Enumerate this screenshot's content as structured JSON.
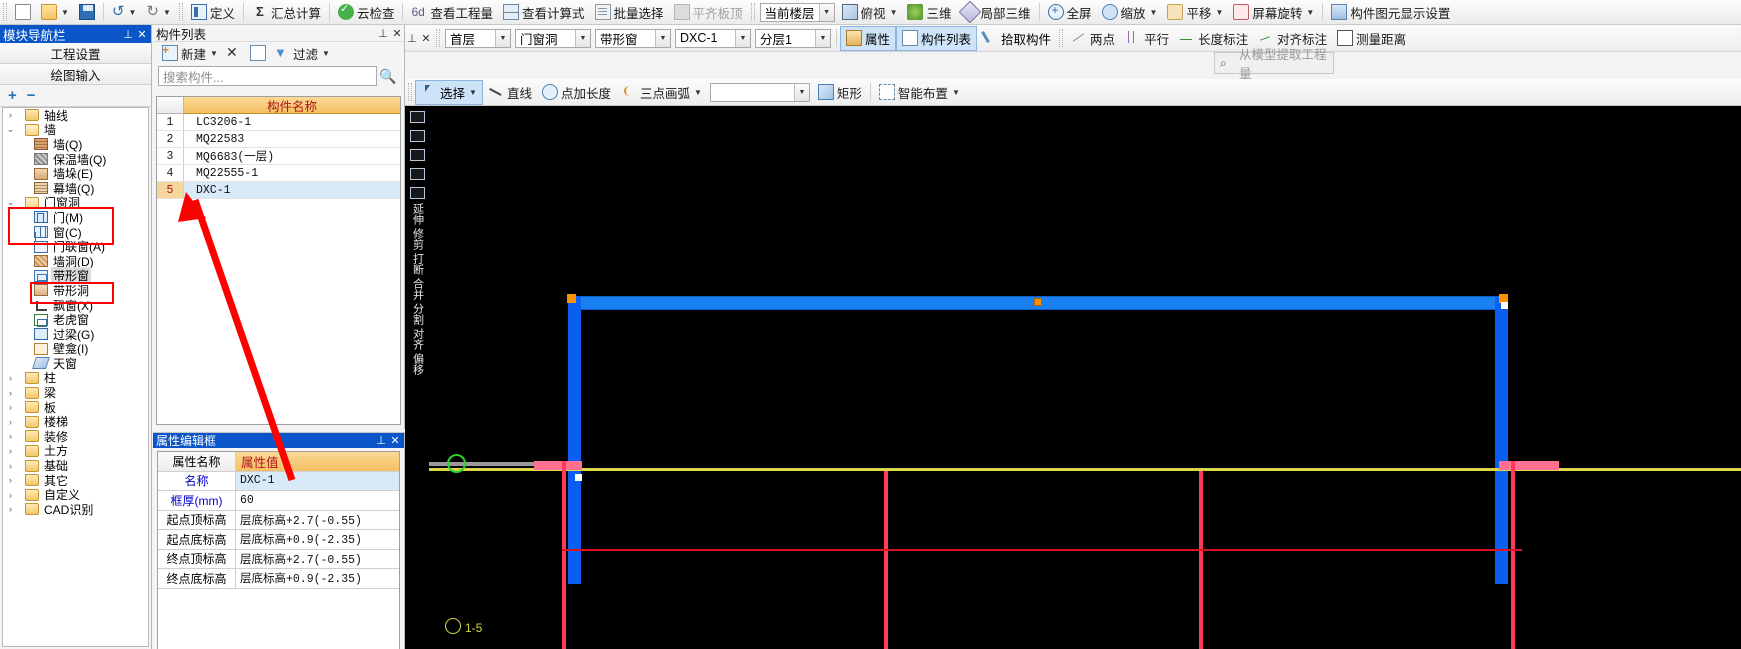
{
  "app": {
    "accent_blue": "#0a56c8",
    "header_orange": "#f4c063",
    "annotation_red": "#ff0000"
  },
  "toolbar_top": {
    "file_items": [
      {
        "name": "new-file",
        "icon": "document-icon",
        "label": ""
      },
      {
        "name": "open-file",
        "icon": "folder-open-icon",
        "label": ""
      },
      {
        "name": "save-file",
        "icon": "save-icon",
        "label": ""
      },
      {
        "name": "undo",
        "icon": "undo-arrow-icon",
        "label": ""
      },
      {
        "name": "redo",
        "icon": "redo-arrow-icon",
        "label": ""
      }
    ],
    "items": [
      {
        "label": "定义",
        "icon": "define-icon",
        "disabled": false,
        "caret": false
      },
      {
        "label": "汇总计算",
        "icon": "sigma-icon",
        "disabled": false,
        "caret": false
      },
      {
        "label": "云检查",
        "icon": "cloud-check-icon",
        "disabled": false,
        "caret": false
      },
      {
        "label": "查看工程量",
        "icon": "view-quantity-icon",
        "disabled": false,
        "caret": false
      },
      {
        "label": "查看计算式",
        "icon": "view-formula-icon",
        "disabled": false,
        "caret": false
      },
      {
        "label": "批量选择",
        "icon": "batch-select-icon",
        "disabled": false,
        "caret": false
      },
      {
        "label": "平齐板顶",
        "icon": "flush-slab-icon",
        "disabled": true,
        "caret": false
      }
    ],
    "floor_select": "当前楼层",
    "view_items": [
      {
        "label": "俯视",
        "icon": "top-view-icon",
        "caret": true
      },
      {
        "label": "三维",
        "icon": "three-d-icon",
        "caret": false
      },
      {
        "label": "局部三维",
        "icon": "partial-three-d-icon",
        "caret": false
      }
    ],
    "zoom_items": [
      {
        "label": "全屏",
        "icon": "fullscreen-icon",
        "caret": false
      },
      {
        "label": "缩放",
        "icon": "zoom-icon",
        "caret": true
      },
      {
        "label": "平移",
        "icon": "pan-icon",
        "caret": true
      },
      {
        "label": "屏幕旋转",
        "icon": "screen-rotate-icon",
        "caret": true
      },
      {
        "label": "构件图元显示设置",
        "icon": "element-display-icon",
        "caret": false
      }
    ]
  },
  "nav_panel": {
    "title": "模块导航栏",
    "pin": "📌",
    "close": "✕",
    "buttons": [
      "工程设置",
      "绘图输入"
    ],
    "expand_all": "+",
    "collapse_all": "−",
    "tree": [
      {
        "label": "轴线",
        "level": 0,
        "type": "folder",
        "expander": ">",
        "icon": "folder-icon"
      },
      {
        "label": "墙",
        "level": 0,
        "type": "folder",
        "expander": "v",
        "icon": "folder-open-icon"
      },
      {
        "label": "墙(Q)",
        "level": 1,
        "type": "leaf",
        "icon": "wall-icon"
      },
      {
        "label": "保温墙(Q)",
        "level": 1,
        "type": "leaf",
        "icon": "insulation-wall-icon"
      },
      {
        "label": "墙垛(E)",
        "level": 1,
        "type": "leaf",
        "icon": "wall-pier-icon"
      },
      {
        "label": "幕墙(Q)",
        "level": 1,
        "type": "leaf",
        "icon": "curtain-wall-icon"
      },
      {
        "label": "门窗洞",
        "level": 0,
        "type": "folder",
        "expander": "v",
        "icon": "folder-open-icon",
        "highlight_box": true
      },
      {
        "label": "门(M)",
        "level": 1,
        "type": "leaf",
        "icon": "door-icon",
        "highlight_box": true
      },
      {
        "label": "窗(C)",
        "level": 1,
        "type": "leaf",
        "icon": "window-icon"
      },
      {
        "label": "门联窗(A)",
        "level": 1,
        "type": "leaf",
        "icon": "door-window-icon"
      },
      {
        "label": "墙洞(D)",
        "level": 1,
        "type": "leaf",
        "icon": "wall-hole-icon"
      },
      {
        "label": "带形窗",
        "level": 1,
        "type": "leaf",
        "icon": "strip-window-icon",
        "selected": true,
        "highlight_box": true
      },
      {
        "label": "带形洞",
        "level": 1,
        "type": "leaf",
        "icon": "strip-hole-icon"
      },
      {
        "label": "飘窗(X)",
        "level": 1,
        "type": "leaf",
        "icon": "bay-window-icon"
      },
      {
        "label": "老虎窗",
        "level": 1,
        "type": "leaf",
        "icon": "dormer-window-icon"
      },
      {
        "label": "过梁(G)",
        "level": 1,
        "type": "leaf",
        "icon": "lintel-icon"
      },
      {
        "label": "壁龛(I)",
        "level": 1,
        "type": "leaf",
        "icon": "niche-icon"
      },
      {
        "label": "天窗",
        "level": 1,
        "type": "leaf",
        "icon": "skylight-icon"
      },
      {
        "label": "柱",
        "level": 0,
        "type": "folder",
        "expander": ">",
        "icon": "folder-icon"
      },
      {
        "label": "梁",
        "level": 0,
        "type": "folder",
        "expander": ">",
        "icon": "folder-icon"
      },
      {
        "label": "板",
        "level": 0,
        "type": "folder",
        "expander": ">",
        "icon": "folder-icon"
      },
      {
        "label": "楼梯",
        "level": 0,
        "type": "folder",
        "expander": ">",
        "icon": "folder-icon"
      },
      {
        "label": "装修",
        "level": 0,
        "type": "folder",
        "expander": ">",
        "icon": "folder-icon"
      },
      {
        "label": "土方",
        "level": 0,
        "type": "folder",
        "expander": ">",
        "icon": "folder-icon"
      },
      {
        "label": "基础",
        "level": 0,
        "type": "folder",
        "expander": ">",
        "icon": "folder-icon"
      },
      {
        "label": "其它",
        "level": 0,
        "type": "folder",
        "expander": ">",
        "icon": "folder-icon"
      },
      {
        "label": "自定义",
        "level": 0,
        "type": "folder",
        "expander": ">",
        "icon": "folder-icon"
      },
      {
        "label": "CAD识别",
        "level": 0,
        "type": "folder",
        "expander": ">",
        "icon": "folder-icon"
      }
    ]
  },
  "component_panel": {
    "title": "构件列表",
    "pin": "📌",
    "close": "✕",
    "tools": [
      {
        "label": "新建",
        "icon": "new-component-icon",
        "caret": true
      },
      {
        "label": "",
        "icon": "delete-icon",
        "caret": false
      },
      {
        "label": "",
        "icon": "copy-icon",
        "caret": false
      },
      {
        "label": "过滤",
        "icon": "filter-icon",
        "caret": true
      }
    ],
    "search_placeholder": "搜索构件...",
    "search_value": "",
    "search_icon": "search-icon",
    "column_header_index": "",
    "column_header_name": "构件名称",
    "rows": [
      {
        "index": "1",
        "name": "LC3206-1",
        "selected": false
      },
      {
        "index": "2",
        "name": "MQ22583",
        "selected": false
      },
      {
        "index": "3",
        "name": "MQ6683(一层)",
        "selected": false
      },
      {
        "index": "4",
        "name": "MQ22555-1",
        "selected": false
      },
      {
        "index": "5",
        "name": "DXC-1",
        "selected": true
      }
    ]
  },
  "property_panel": {
    "title": "属性编辑框",
    "pin": "📌",
    "close": "✕",
    "header_name": "属性名称",
    "header_value": "属性值",
    "rows": [
      {
        "name": "名称",
        "value": "DXC-1",
        "blue": true,
        "selected": true
      },
      {
        "name": "框厚(mm)",
        "value": "60",
        "blue": true,
        "selected": false
      },
      {
        "name": "起点顶标高",
        "value": "层底标高+2.7(-0.55)",
        "blue": false,
        "selected": false
      },
      {
        "name": "起点底标高",
        "value": "层底标高+0.9(-2.35)",
        "blue": false,
        "selected": false
      },
      {
        "name": "终点顶标高",
        "value": "层底标高+2.7(-0.55)",
        "blue": false,
        "selected": false
      },
      {
        "name": "终点底标高",
        "value": "层底标高+0.9(-2.35)",
        "blue": false,
        "selected": false
      }
    ]
  },
  "context_bar": {
    "pin": "📌",
    "close": "✕",
    "selectors": [
      {
        "name": "floor-select",
        "value": "首层"
      },
      {
        "name": "category-select",
        "value": "门窗洞"
      },
      {
        "name": "type-select",
        "value": "带形窗"
      },
      {
        "name": "component-select",
        "value": "DXC-1"
      },
      {
        "name": "layer-select",
        "value": "分层1"
      }
    ],
    "toggles": [
      {
        "label": "属性",
        "icon": "property-icon",
        "active": true
      },
      {
        "label": "构件列表",
        "icon": "component-list-icon",
        "active": true
      },
      {
        "label": "拾取构件",
        "icon": "pick-component-icon",
        "active": false
      }
    ],
    "measure_tools": [
      {
        "label": "两点",
        "icon": "two-point-icon"
      },
      {
        "label": "平行",
        "icon": "parallel-icon"
      },
      {
        "label": "长度标注",
        "icon": "length-dimension-icon"
      },
      {
        "label": "对齐标注",
        "icon": "align-dimension-icon"
      },
      {
        "label": "测量距离",
        "icon": "measure-distance-icon"
      }
    ],
    "extract_button": {
      "label": "从模型提取工程量",
      "icon": "extract-icon",
      "disabled": true
    }
  },
  "draw_bar": {
    "tools": [
      {
        "label": "选择",
        "icon": "cursor-select-icon",
        "caret": true,
        "active": true
      },
      {
        "label": "直线",
        "icon": "line-icon",
        "caret": false,
        "active": false
      },
      {
        "label": "点加长度",
        "icon": "point-length-icon",
        "caret": false,
        "active": false
      },
      {
        "label": "三点画弧",
        "icon": "three-point-arc-icon",
        "caret": true,
        "active": false
      }
    ],
    "blank_combo_value": "",
    "shape_tools": [
      {
        "label": "矩形",
        "icon": "rectangle-icon",
        "caret": false
      },
      {
        "label": "智能布置",
        "icon": "smart-layout-icon",
        "caret": true
      }
    ]
  },
  "vertical_toolbar": {
    "items": [
      {
        "label": "",
        "icon": "trim-tool-icon",
        "type": "icon"
      },
      {
        "label": "",
        "icon": "extend-tool-icon",
        "type": "icon"
      },
      {
        "label": "",
        "icon": "chamfer-tool-icon",
        "type": "icon"
      },
      {
        "label": "",
        "icon": "offset-tool-icon",
        "type": "icon"
      },
      {
        "label": "",
        "icon": "rotate-tool-icon",
        "type": "icon"
      },
      {
        "label": "延伸",
        "icon": "extend-icon",
        "type": "text"
      },
      {
        "label": "修剪",
        "icon": "trim-icon",
        "type": "text"
      },
      {
        "label": "打断",
        "icon": "break-icon",
        "type": "text"
      },
      {
        "label": "合并",
        "icon": "merge-icon",
        "type": "text"
      },
      {
        "label": "分割",
        "icon": "split-icon",
        "type": "text"
      },
      {
        "label": "对齐",
        "icon": "align-icon",
        "type": "text"
      },
      {
        "label": "偏移",
        "icon": "offset-icon",
        "type": "text"
      }
    ]
  },
  "canvas": {
    "background": "#000000",
    "axis_label": "1-5",
    "selection_color": "#ff9000",
    "element_color": "#1a7ff0"
  }
}
